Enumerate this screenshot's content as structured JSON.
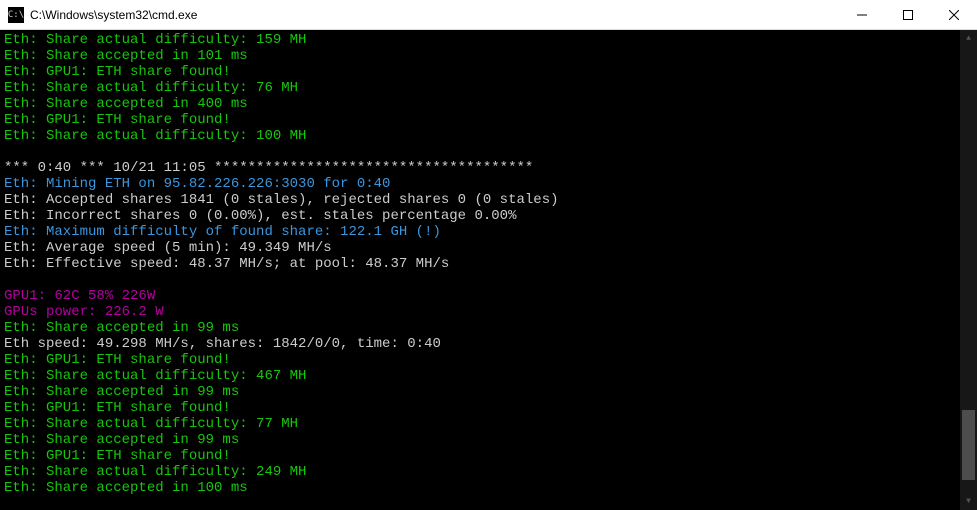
{
  "titlebar": {
    "icon_glyph": "C:\\",
    "title": "C:\\Windows\\system32\\cmd.exe"
  },
  "lines": [
    {
      "color": "green",
      "text": "Eth: Share actual difficulty: 159 MH"
    },
    {
      "color": "green",
      "text": "Eth: Share accepted in 101 ms"
    },
    {
      "color": "green",
      "text": "Eth: GPU1: ETH share found!"
    },
    {
      "color": "green",
      "text": "Eth: Share actual difficulty: 76 MH"
    },
    {
      "color": "green",
      "text": "Eth: Share accepted in 400 ms"
    },
    {
      "color": "green",
      "text": "Eth: GPU1: ETH share found!"
    },
    {
      "color": "green",
      "text": "Eth: Share actual difficulty: 100 MH"
    },
    {
      "color": "empty",
      "text": ""
    },
    {
      "color": "white",
      "text": "*** 0:40 *** 10/21 11:05 **************************************"
    },
    {
      "color": "cyan",
      "text": "Eth: Mining ETH on 95.82.226.226:3030 for 0:40"
    },
    {
      "color": "white",
      "text": "Eth: Accepted shares 1841 (0 stales), rejected shares 0 (0 stales)"
    },
    {
      "color": "white",
      "text": "Eth: Incorrect shares 0 (0.00%), est. stales percentage 0.00%"
    },
    {
      "color": "cyan",
      "text": "Eth: Maximum difficulty of found share: 122.1 GH (!)"
    },
    {
      "color": "white",
      "text": "Eth: Average speed (5 min): 49.349 MH/s"
    },
    {
      "color": "white",
      "text": "Eth: Effective speed: 48.37 MH/s; at pool: 48.37 MH/s"
    },
    {
      "color": "empty",
      "text": ""
    },
    {
      "color": "magenta",
      "text": "GPU1: 62C 58% 226W"
    },
    {
      "color": "magenta",
      "text": "GPUs power: 226.2 W"
    },
    {
      "color": "green",
      "text": "Eth: Share accepted in 99 ms"
    },
    {
      "color": "white",
      "text": "Eth speed: 49.298 MH/s, shares: 1842/0/0, time: 0:40"
    },
    {
      "color": "green",
      "text": "Eth: GPU1: ETH share found!"
    },
    {
      "color": "green",
      "text": "Eth: Share actual difficulty: 467 MH"
    },
    {
      "color": "green",
      "text": "Eth: Share accepted in 99 ms"
    },
    {
      "color": "green",
      "text": "Eth: GPU1: ETH share found!"
    },
    {
      "color": "green",
      "text": "Eth: Share actual difficulty: 77 MH"
    },
    {
      "color": "green",
      "text": "Eth: Share accepted in 99 ms"
    },
    {
      "color": "green",
      "text": "Eth: GPU1: ETH share found!"
    },
    {
      "color": "green",
      "text": "Eth: Share actual difficulty: 249 MH"
    },
    {
      "color": "green",
      "text": "Eth: Share accepted in 100 ms"
    }
  ]
}
